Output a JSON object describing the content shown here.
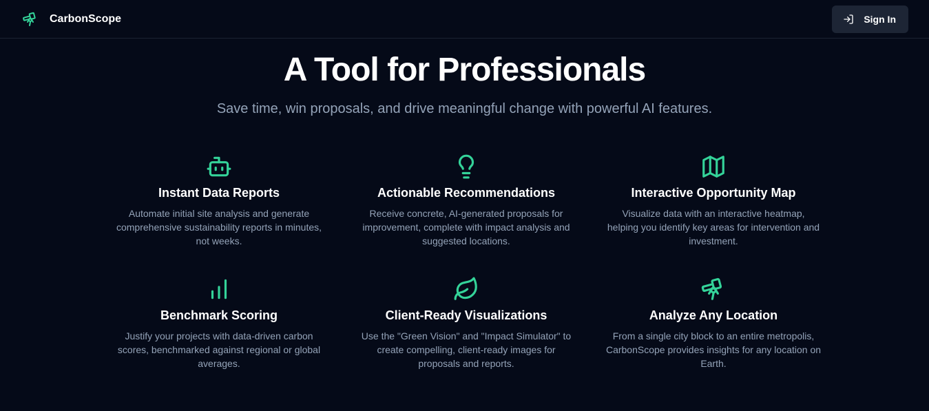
{
  "header": {
    "brand_name": "CarbonScope",
    "brand_icon": "telescope-icon",
    "signin_label": "Sign In",
    "signin_icon": "sign-in-icon"
  },
  "hero": {
    "title": "A Tool for Professionals",
    "subtitle": "Save time, win proposals, and drive meaningful change with powerful AI features."
  },
  "features": [
    {
      "icon": "bot-icon",
      "title": "Instant Data Reports",
      "description": "Automate initial site analysis and generate comprehensive sustainability reports in minutes, not weeks."
    },
    {
      "icon": "lightbulb-icon",
      "title": "Actionable Recommendations",
      "description": "Receive concrete, AI-generated proposals for improvement, complete with impact analysis and suggested locations."
    },
    {
      "icon": "map-icon",
      "title": "Interactive Opportunity Map",
      "description": "Visualize data with an interactive heatmap, helping you identify key areas for intervention and investment."
    },
    {
      "icon": "bar-chart-icon",
      "title": "Benchmark Scoring",
      "description": "Justify your projects with data-driven carbon scores, benchmarked against regional or global averages."
    },
    {
      "icon": "leaf-icon",
      "title": "Client-Ready Visualizations",
      "description": "Use the \"Green Vision\" and \"Impact Simulator\" to create compelling, client-ready images for proposals and reports."
    },
    {
      "icon": "telescope-icon",
      "title": "Analyze Any Location",
      "description": "From a single city block to an entire metropolis, CarbonScope provides insights for any location on Earth."
    }
  ],
  "colors": {
    "background": "#050a18",
    "accent": "#34d399",
    "muted_text": "#94a3b8",
    "button_bg": "#1d2535"
  }
}
